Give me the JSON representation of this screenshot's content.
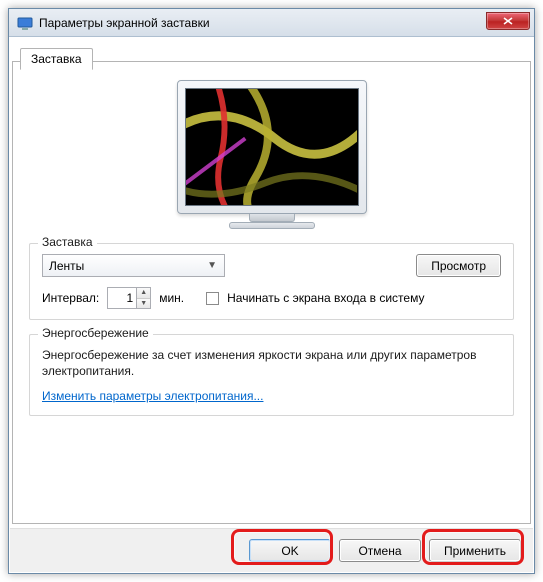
{
  "window": {
    "title": "Параметры экранной заставки"
  },
  "tab": {
    "label": "Заставка"
  },
  "screensaver_group": {
    "legend": "Заставка",
    "selected": "Ленты",
    "preview_button": "Просмотр",
    "interval_label": "Интервал:",
    "interval_value": "1",
    "interval_unit": "мин.",
    "resume_checkbox_label": "Начинать с экрана входа в систему",
    "resume_checked": false
  },
  "energy_group": {
    "legend": "Энергосбережение",
    "text": "Энергосбережение за счет изменения яркости экрана или других параметров электропитания.",
    "link": "Изменить параметры электропитания..."
  },
  "buttons": {
    "ok": "OK",
    "cancel": "Отмена",
    "apply": "Применить"
  }
}
